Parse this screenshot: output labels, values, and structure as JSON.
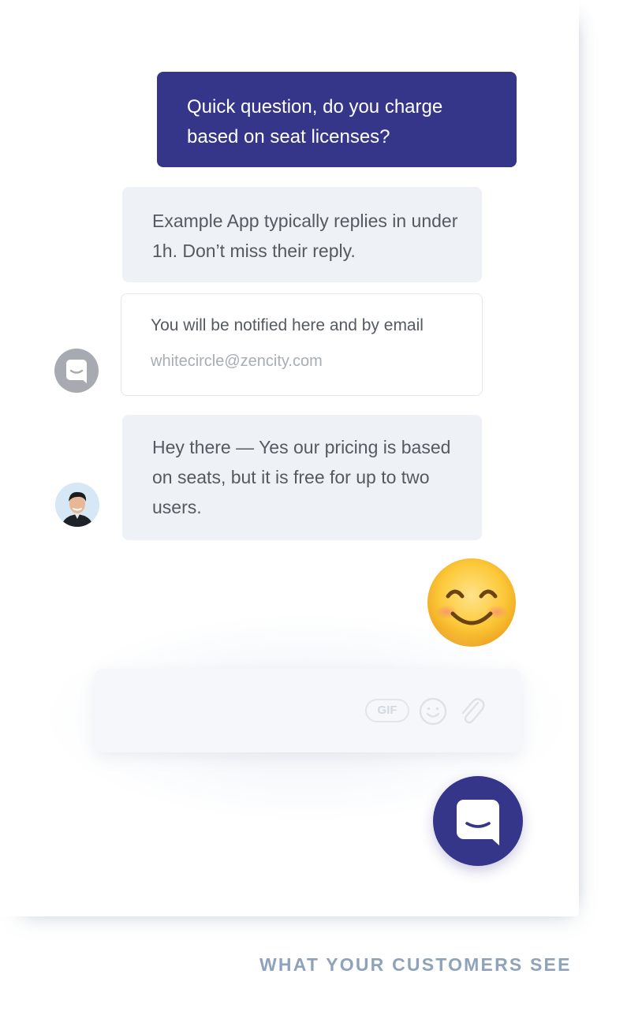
{
  "conversation": {
    "user_message": "Quick question, do you charge based on seat licenses?",
    "auto_reply": "Example App typically replies in under 1h. Don’t miss their reply.",
    "notify": {
      "label": "You will be notified here and by email",
      "email": "whitecircle@zencity.com"
    },
    "agent_reply": "Hey there — Yes our pricing is based on seats, but it is free for up to two users.",
    "reaction_emoji": "smiling-face-emoji"
  },
  "composer": {
    "gif_label": "GIF",
    "icons": [
      "emoji-icon",
      "paperclip-icon"
    ]
  },
  "launcher": {
    "icon": "chat-bubble-icon"
  },
  "caption": "WHAT YOUR CUSTOMERS SEE",
  "colors": {
    "brand": "#35358a",
    "operator_bubble": "#eef1f6",
    "caption": "#8ea3bb"
  }
}
